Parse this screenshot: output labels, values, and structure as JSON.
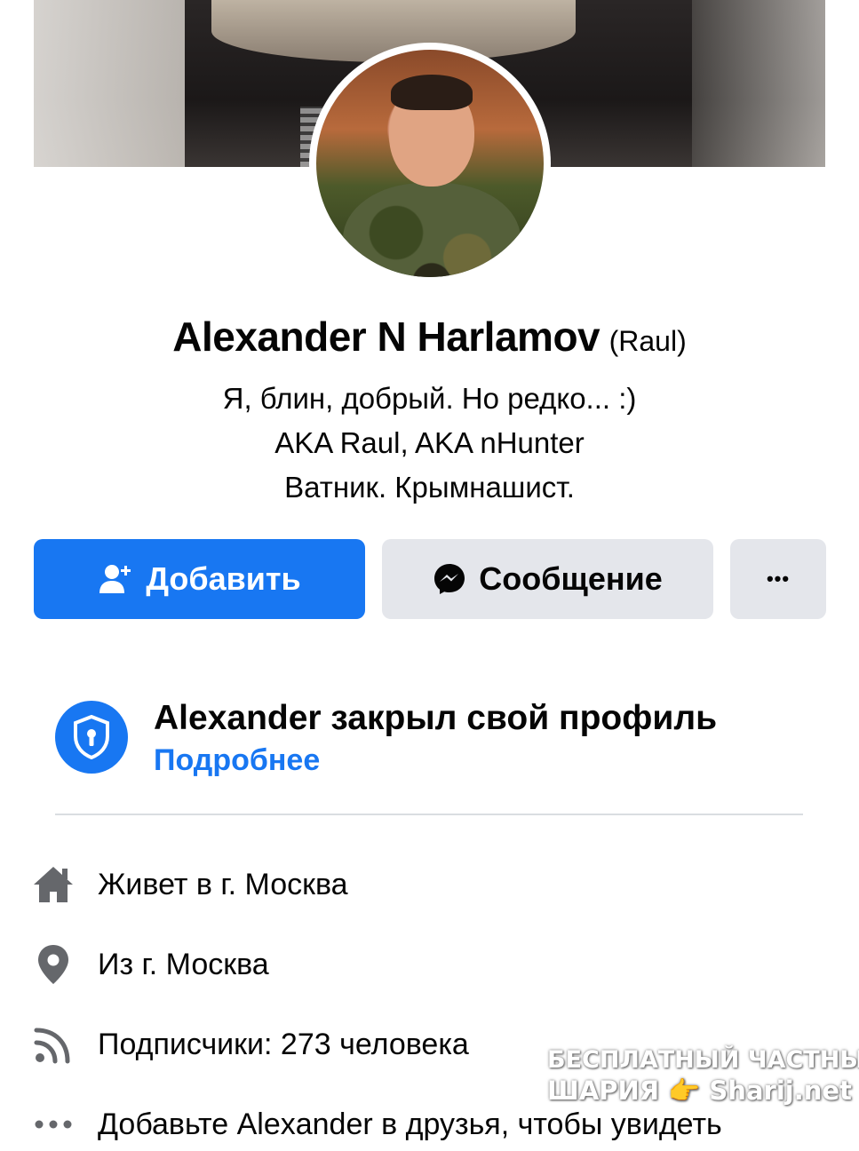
{
  "profile": {
    "name": "Alexander N Harlamov",
    "alternate_name": "(Raul)",
    "bio": [
      "Я, блин, добрый. Но редко...  :)",
      "AKA Raul, AKA nHunter",
      "Ватник. Крымнашист."
    ]
  },
  "actions": {
    "add_label": "Добавить",
    "message_label": "Сообщение",
    "more_label": "•••"
  },
  "locked_notice": {
    "title": "Alexander закрыл свой профиль",
    "link": "Подробнее"
  },
  "info": {
    "lives_in": "Живет в г. Москва",
    "from": "Из г. Москва",
    "followers": "Подписчики: 273 человека",
    "add_prompt": "Добавьте Alexander в друзья, чтобы увидеть"
  },
  "watermark": {
    "line1": "БЕСПЛАТНЫЙ ЧАСТНЫЙ",
    "line2": "ШАРИЯ 👉 Sharij.net"
  },
  "colors": {
    "accent": "#1877f2",
    "secondary_button": "#e4e6eb",
    "icon_gray": "#65676b"
  }
}
